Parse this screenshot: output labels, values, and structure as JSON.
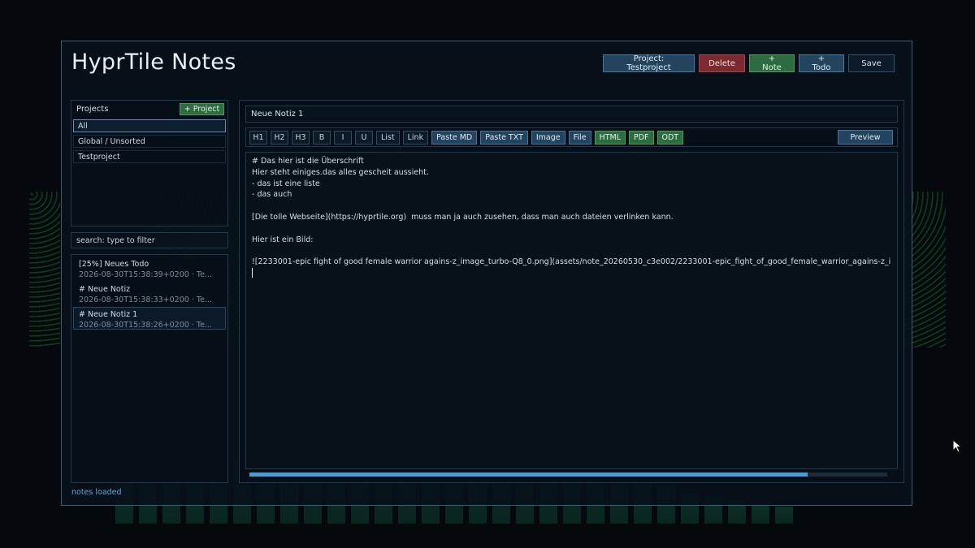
{
  "app": {
    "title": "HyprTile Notes"
  },
  "topbar": {
    "project_label": "Project: Testproject",
    "delete_label": "Delete",
    "note_label": "+ Note",
    "todo_label": "+ Todo",
    "save_label": "Save"
  },
  "sidebar": {
    "projects_header": "Projects",
    "add_project_label": "+ Project",
    "projects": [
      {
        "label": "All",
        "active": true
      },
      {
        "label": "Global / Unsorted"
      },
      {
        "label": "Testproject"
      }
    ],
    "search": {
      "placeholder": "search: type to filter",
      "value": ""
    },
    "notes": [
      {
        "title": "[25%] Neues Todo",
        "meta": "2026-08-30T15:38:39+0200  ·  Te..."
      },
      {
        "title": "# Neue Notiz",
        "meta": "2026-08-30T15:38:33+0200  ·  Te..."
      },
      {
        "title": "# Neue Notiz 1",
        "meta": "2026-08-30T15:38:26+0200  ·  Te...",
        "active": true
      }
    ],
    "status": "notes loaded"
  },
  "editor": {
    "title_value": "Neue Notiz 1",
    "toolbar": {
      "h1": "H1",
      "h2": "H2",
      "h3": "H3",
      "bold": "B",
      "italic": "I",
      "underline": "U",
      "list": "List",
      "link": "Link",
      "paste_md": "Paste MD",
      "paste_txt": "Paste TXT",
      "image": "Image",
      "file": "File",
      "html": "HTML",
      "pdf": "PDF",
      "odt": "ODT",
      "preview": "Preview"
    },
    "lines": [
      "# Das hier ist die Überschrift",
      "Hier steht einiges.das alles gescheit aussieht.",
      "- das ist eine liste",
      "- das auch",
      "",
      "[Die tolle Webseite](https://hyprtile.org)  muss man ja auch zusehen, dass man auch dateien verlinken kann.",
      "",
      "Hier ist ein Bild:",
      "",
      "![2233001-epic fight of good female warrior agains-z_image_turbo-Q8_0.png](assets/note_20260530_c3e002/2233001-epic_fight_of_good_female_warrior_agains-z_i"
    ],
    "scroll_fraction": 0.875
  },
  "colors": {
    "accent_blue": "#4b9ad0",
    "button_green": "#2d6b40",
    "button_red": "#7b2a30",
    "button_blue": "#22445f"
  }
}
